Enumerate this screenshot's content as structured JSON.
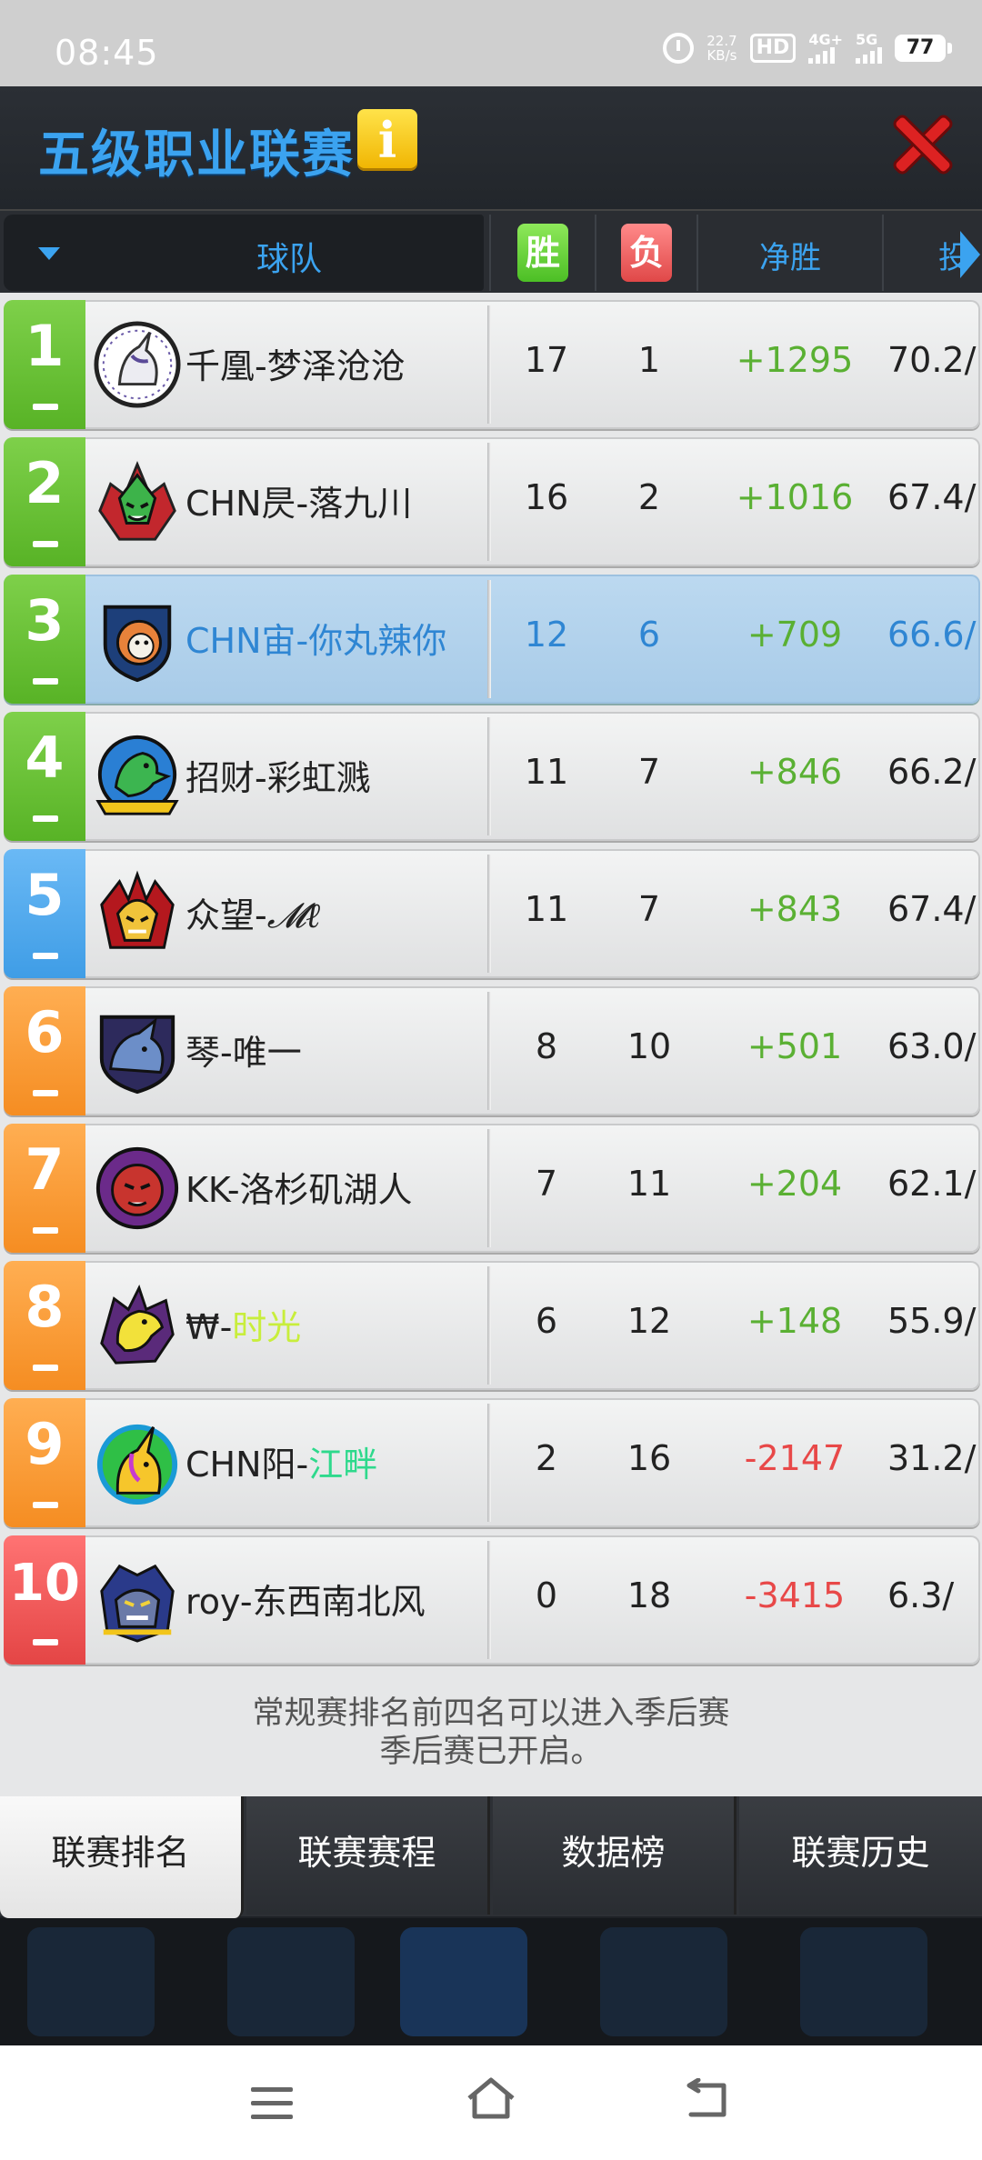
{
  "status_bar": {
    "time": "08:45",
    "net_speed_value": "22.7",
    "net_speed_unit": "KB/s",
    "hd_label": "HD",
    "signal_1_label": "4G+",
    "signal_2_label": "5G",
    "battery": "77"
  },
  "header": {
    "title": "五级职业联赛",
    "info_icon_glyph": "i"
  },
  "columns": {
    "team": "球队",
    "wins": "胜",
    "losses": "负",
    "net": "净胜",
    "pct": "投"
  },
  "colors": {
    "accent": "#3ba3f0",
    "positive": "#5ab033",
    "negative": "#e84848",
    "rank_green": "#58b326",
    "rank_blue": "#3f9de6",
    "rank_orange": "#f58d22",
    "rank_red": "#e44545"
  },
  "standings": [
    {
      "rank": "1",
      "prefix": "千凰-梦泽沧沧",
      "suffix": "",
      "wins": "17",
      "losses": "1",
      "net": "+1295",
      "pct": "70.2/"
    },
    {
      "rank": "2",
      "prefix": "CHN昃-落九川",
      "suffix": "",
      "wins": "16",
      "losses": "2",
      "net": "+1016",
      "pct": "67.4/"
    },
    {
      "rank": "3",
      "prefix": "CHN宙-你丸辣你",
      "suffix": "",
      "wins": "12",
      "losses": "6",
      "net": "+709",
      "pct": "66.6/"
    },
    {
      "rank": "4",
      "prefix": "招财-彩虹溅",
      "suffix": "",
      "wins": "11",
      "losses": "7",
      "net": "+846",
      "pct": "66.2/"
    },
    {
      "rank": "5",
      "prefix": "众望-",
      "suffix": "𝓜ℓ",
      "wins": "11",
      "losses": "7",
      "net": "+843",
      "pct": "67.4/"
    },
    {
      "rank": "6",
      "prefix": "琴-唯一",
      "suffix": "",
      "wins": "8",
      "losses": "10",
      "net": "+501",
      "pct": "63.0/"
    },
    {
      "rank": "7",
      "prefix": "KK-洛杉矶湖人",
      "suffix": "",
      "wins": "7",
      "losses": "11",
      "net": "+204",
      "pct": "62.1/"
    },
    {
      "rank": "8",
      "prefix": "₩-",
      "suffix": "时光",
      "wins": "6",
      "losses": "12",
      "net": "+148",
      "pct": "55.9/"
    },
    {
      "rank": "9",
      "prefix": "CHN阳-",
      "suffix": "江畔",
      "wins": "2",
      "losses": "16",
      "net": "-2147",
      "pct": "31.2/"
    },
    {
      "rank": "10",
      "prefix": "roy-东西南北风",
      "suffix": "",
      "wins": "0",
      "losses": "18",
      "net": "-3415",
      "pct": "6.3/"
    }
  ],
  "note": {
    "line1": "常规赛排名前四名可以进入季后赛",
    "line2": "季后赛已开启。"
  },
  "tabs": [
    "联赛排名",
    "联赛赛程",
    "数据榜",
    "联赛历史"
  ],
  "icons": {
    "sort": "triangle-down-icon",
    "close": "close-icon",
    "scroll_right": "arrow-right-icon",
    "nav_menu": "menu-icon",
    "nav_home": "home-icon",
    "nav_back": "back-icon"
  }
}
